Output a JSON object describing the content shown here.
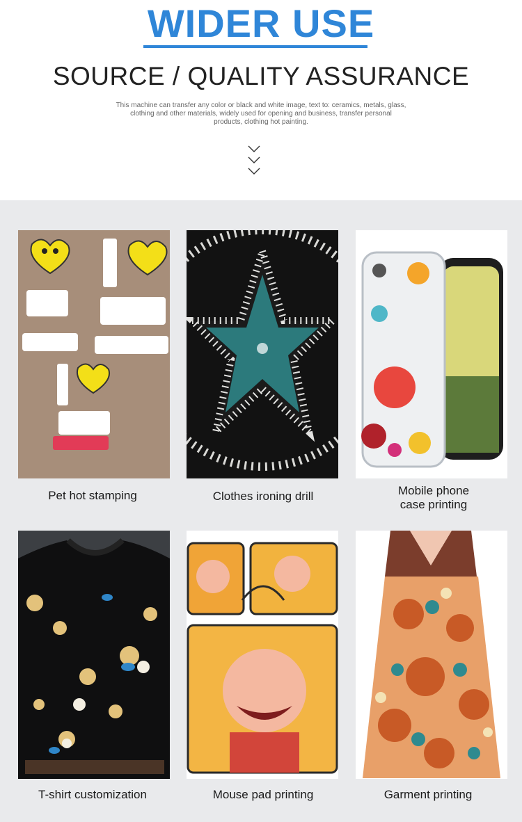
{
  "header": {
    "title": "WIDER USE",
    "subtitle": "SOURCE / QUALITY ASSURANCE",
    "description_lines": [
      "This machine can transfer any color or black and white image, text to: ceramics, metals, glass,",
      "clothing and other materials, widely used for opening and business, transfer personal",
      "products, clothing hot painting."
    ]
  },
  "tiles": [
    {
      "caption_lines": [
        "Pet hot stamping"
      ],
      "image": "i-love-my-family-prints"
    },
    {
      "caption_lines": [
        "Clothes ironing drill"
      ],
      "image": "rhinestone-star"
    },
    {
      "caption_lines": [
        "Mobile phone",
        "case printing"
      ],
      "image": "floral-phone-case"
    },
    {
      "caption_lines": [
        "T-shirt customization"
      ],
      "image": "floral-black-tshirt"
    },
    {
      "caption_lines": [
        "Mouse pad printing"
      ],
      "image": "cartoon-mouse-pad"
    },
    {
      "caption_lines": [
        "Garment printing"
      ],
      "image": "patterned-dress"
    }
  ],
  "colors": {
    "accent": "#2f86d8",
    "gallery_bg": "#e9eaec"
  }
}
